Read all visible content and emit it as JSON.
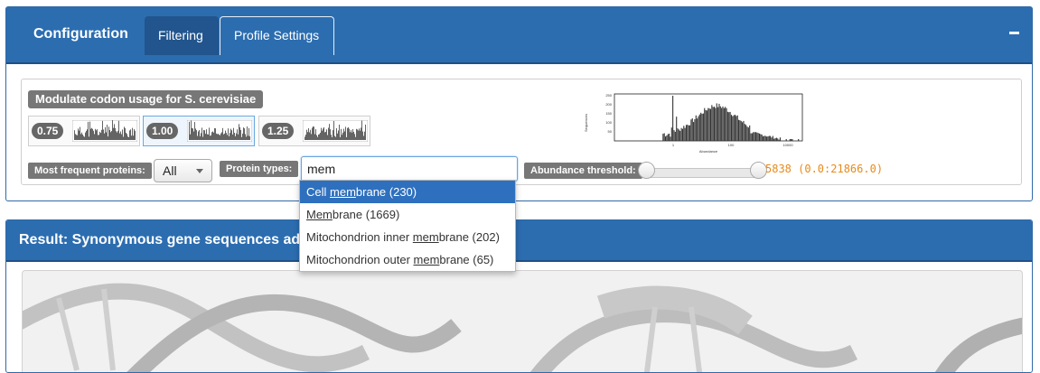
{
  "config": {
    "title": "Configuration",
    "tabs": [
      {
        "label": "Filtering"
      },
      {
        "label": "Profile Settings"
      }
    ],
    "collapse_icon": "minus-icon"
  },
  "codon": {
    "title": "Modulate codon usage for S. cerevisiae",
    "options": [
      {
        "label": "0.75"
      },
      {
        "label": "1.00"
      },
      {
        "label": "1.25"
      }
    ],
    "selected": "1.00"
  },
  "filters": {
    "frequent_label": "Most frequent proteins:",
    "frequent_value": "All",
    "types_label": "Protein types:",
    "types_query": "mem",
    "abundance_label": "Abundance threshold:",
    "abundance_value": "5838 (0.0:21866.0)"
  },
  "histogram": {
    "ylabel": "Sequences",
    "xlabel": "Abundance",
    "yticks": [
      "250",
      "200",
      "150",
      "100",
      "50"
    ],
    "xticks": [
      "1",
      "100",
      "10000"
    ]
  },
  "dropdown": {
    "items": [
      {
        "pre": "Cell ",
        "match": "mem",
        "post": "brane (230)"
      },
      {
        "pre": "",
        "match": "Mem",
        "post": "brane (1669)"
      },
      {
        "pre": "Mitochondrion inner ",
        "match": "mem",
        "post": "brane (202)"
      },
      {
        "pre": "Mitochondrion outer ",
        "match": "mem",
        "post": "brane (65)"
      }
    ]
  },
  "result": {
    "title": "Result: Synonymous gene sequences ada"
  },
  "colors": {
    "header_blue": "#2c6db0",
    "active_item": "#2e70be",
    "threshold_orange": "#e88a1a"
  }
}
